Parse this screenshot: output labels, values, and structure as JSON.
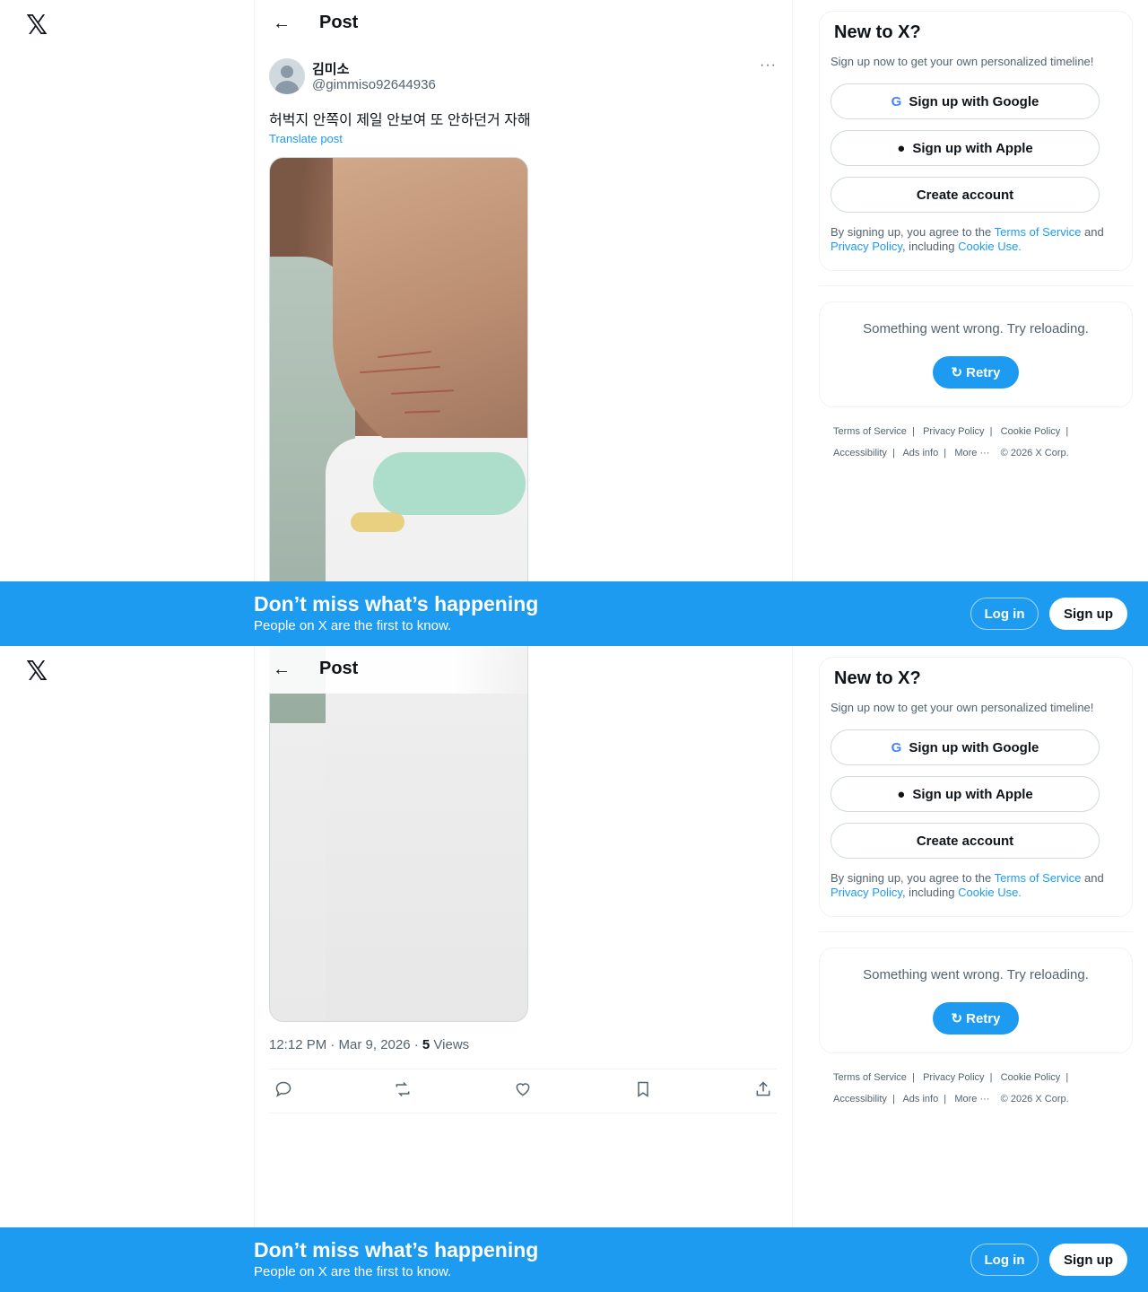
{
  "app": {
    "logo": "𝕏"
  },
  "header": {
    "back_icon": "←",
    "title": "Post"
  },
  "post": {
    "display_name": "김미소",
    "handle": "@gimmiso92644936",
    "more_icon": "···",
    "text": "허벅지 안쪽이 제일 안보여 또 안하던거  자해",
    "translate": "Translate post",
    "time": "12:12 PM · Mar 9, 2026 · ",
    "views_count": "5",
    "views_label": " Views"
  },
  "actions": {
    "reply_icon": "reply-icon",
    "repost_icon": "repost-icon",
    "like_icon": "like-icon",
    "bookmark_icon": "bookmark-icon",
    "share_icon": "share-icon"
  },
  "signup_card": {
    "title": "New to X?",
    "subtitle": "Sign up now to get your own personalized timeline!",
    "google": "Sign up with Google",
    "apple": "Sign up with Apple",
    "create": "Create account",
    "legal_pre": "By signing up, you agree to the ",
    "terms": "Terms of Service",
    "and": " and ",
    "privacy": "Privacy Policy",
    "including": ", including ",
    "cookie": "Cookie Use."
  },
  "error_card": {
    "message": "Something went wrong. Try reloading.",
    "retry": "Retry"
  },
  "footer": {
    "links": [
      "Terms of Service",
      "Privacy Policy",
      "Cookie Policy",
      "Accessibility",
      "Ads info",
      "More ···"
    ],
    "copyright": "© 2026 X Corp."
  },
  "banner": {
    "title": "Don’t miss what’s happening",
    "subtitle": "People on X are the first to know.",
    "login": "Log in",
    "signup": "Sign up"
  },
  "colors": {
    "accent": "#1d9bf0",
    "text": "#0f1419",
    "muted": "#536471"
  }
}
